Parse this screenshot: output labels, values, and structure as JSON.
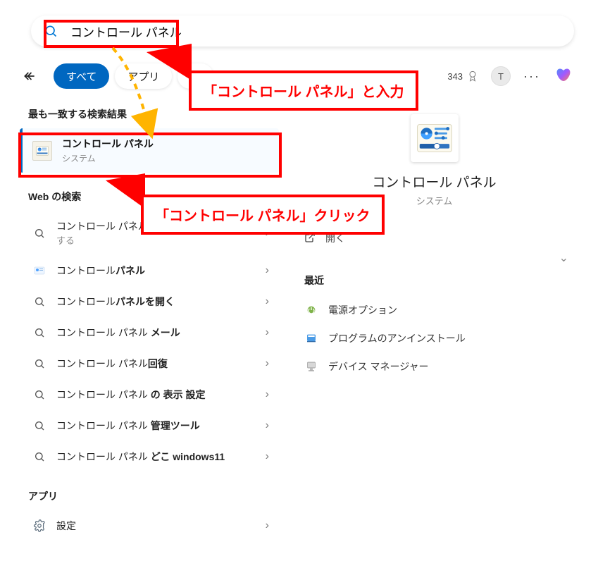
{
  "search": {
    "value": "コントロール パネル"
  },
  "header": {
    "tabs": [
      "すべて",
      "アプリ",
      "ド"
    ],
    "active_index": 0,
    "reward_points": "343",
    "avatar_letter": "T"
  },
  "left": {
    "best_heading": "最も一致する検索結果",
    "best": {
      "title": "コントロール パネル",
      "subtitle": "システム"
    },
    "web_heading": "Web の検索",
    "web_items": [
      {
        "prefix": "コントロール パネル",
        "suffix": " - 検索結果をさらに表示する",
        "sub": true
      },
      {
        "prefix": "コントロール",
        "bold": "パネル"
      },
      {
        "prefix": "コントロール",
        "bold": "パネルを開く"
      },
      {
        "prefix": "コントロール パネル ",
        "bold": "メール"
      },
      {
        "prefix": "コントロール パネル",
        "bold": "回復"
      },
      {
        "prefix": "コントロール パネル ",
        "bold": "の 表示 設定"
      },
      {
        "prefix": "コントロール パネル ",
        "bold": "管理ツール"
      },
      {
        "prefix": "コントロール パネル ",
        "bold": "どこ windows11"
      }
    ],
    "apps_heading": "アプリ",
    "apps_items": [
      {
        "label": "設定"
      }
    ]
  },
  "right": {
    "title": "コントロール パネル",
    "subtitle": "システム",
    "open_label": "開く",
    "recent_heading": "最近",
    "recent_items": [
      {
        "label": "電源オプション",
        "icon": "power"
      },
      {
        "label": "プログラムのアンインストール",
        "icon": "programs"
      },
      {
        "label": "デバイス マネージャー",
        "icon": "device"
      }
    ]
  },
  "annotations": {
    "callout1": "「コントロール パネル」と入力",
    "callout2": "「コントロール パネル」クリック"
  }
}
